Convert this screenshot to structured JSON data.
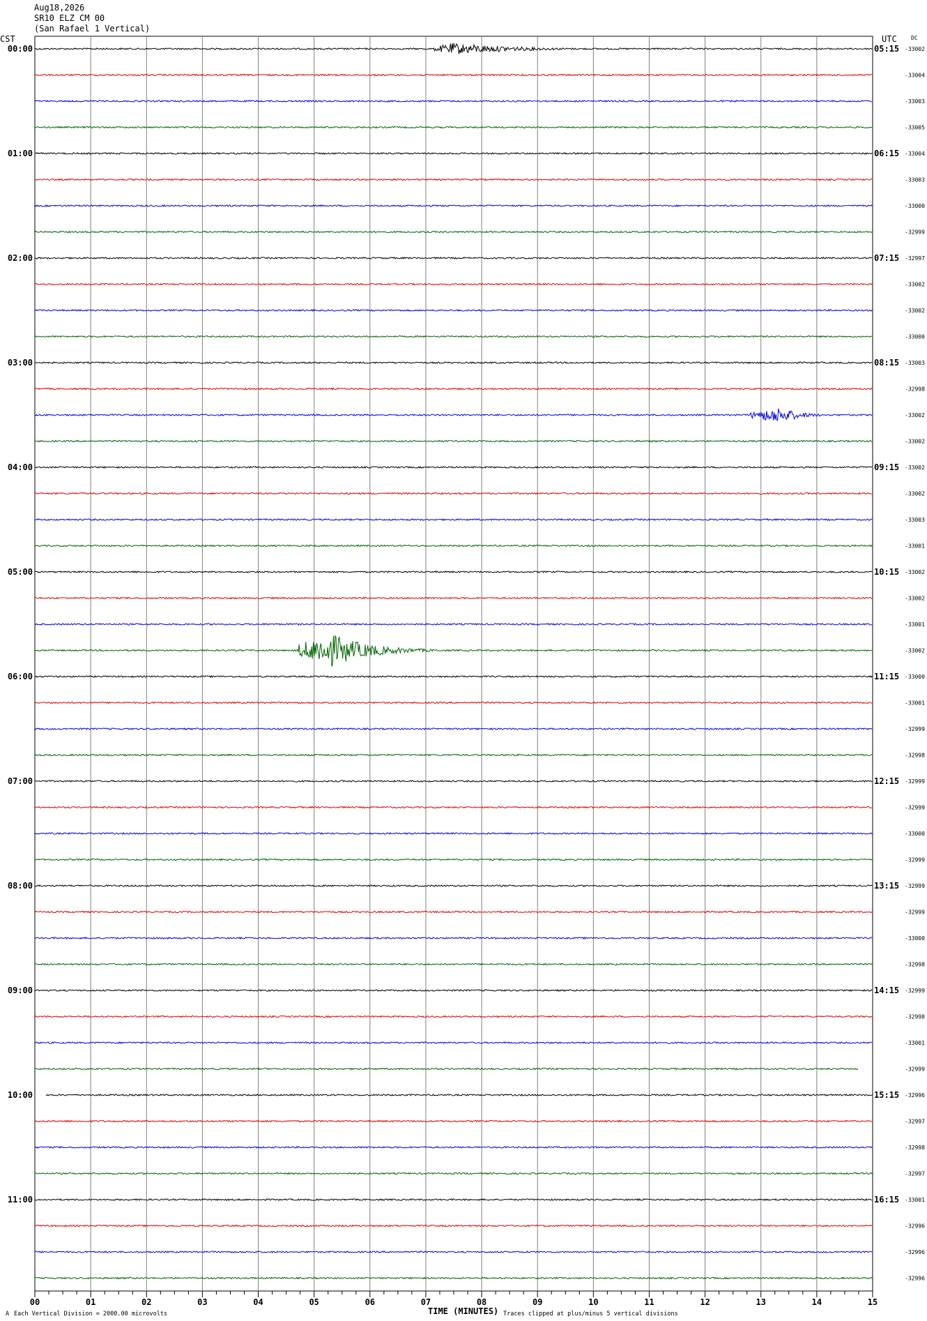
{
  "header": {
    "date": "Aug18,2026",
    "station": "SR10 ELZ CM 00",
    "location": "(San Rafael 1 Vertical)",
    "left_tz": "CST",
    "right_tz": "UTC",
    "dc_label": "DC"
  },
  "footer": {
    "scale_note": "Each Vertical Division = 2000.00 microvolts",
    "xlabel": "TIME (MINUTES)",
    "clip_note": "Traces clipped at plus/minus 5 vertical divisions",
    "corner_mark": "A"
  },
  "colors": {
    "trace_cycle": [
      "#000000",
      "#e00000",
      "#0000e0",
      "#006400"
    ],
    "grid": "#808080"
  },
  "chart_data": {
    "type": "line",
    "description_type": "helicorder",
    "xlim": [
      0,
      15
    ],
    "x_ticks": [
      "00",
      "01",
      "02",
      "03",
      "04",
      "05",
      "06",
      "07",
      "08",
      "09",
      "10",
      "11",
      "12",
      "13",
      "14",
      "15"
    ],
    "rows_per_hour": 4,
    "left_hour_labels": [
      "00:00",
      "01:00",
      "02:00",
      "03:00",
      "04:00",
      "05:00",
      "06:00",
      "07:00",
      "08:00",
      "09:00",
      "10:00",
      "11:00"
    ],
    "right_hour_labels": [
      "05:15",
      "06:15",
      "07:15",
      "08:15",
      "09:15",
      "10:15",
      "11:15",
      "12:15",
      "13:15",
      "14:15",
      "15:15",
      "16:15"
    ],
    "dc_offsets": [
      "-33002",
      "-33004",
      "-33003",
      "-33005",
      "-33004",
      "-33003",
      "-33000",
      "-32999",
      "-32997",
      "-33002",
      "-33002",
      "-33000",
      "-33003",
      "-32998",
      "-33002",
      "-33002",
      "-33002",
      "-33002",
      "-33003",
      "-33001",
      "-33002",
      "-33002",
      "-33001",
      "-33002",
      "-33000",
      "-33001",
      "-32999",
      "-32998",
      "-32999",
      "-32999",
      "-33000",
      "-32999",
      "-32999",
      "-32999",
      "-33000",
      "-32998",
      "-32999",
      "-32998",
      "-33001",
      "-32999",
      "-32996",
      "-32997",
      "-32998",
      "-32997",
      "-33001",
      "-32996",
      "-32996",
      "-32996"
    ],
    "events": [
      {
        "row": 0,
        "start_min": 7.15,
        "peak_min": 7.5,
        "end_min": 11.0,
        "amp_divisions": 0.6
      },
      {
        "row": 1,
        "start_min": 14.5,
        "peak_min": 14.75,
        "end_min": 15.0,
        "amp_divisions": 0.1
      },
      {
        "row": 14,
        "start_min": 12.8,
        "peak_min": 13.35,
        "end_min": 14.5,
        "amp_divisions": 0.8
      },
      {
        "row": 20,
        "start_min": 12.95,
        "peak_min": 13.2,
        "end_min": 15.0,
        "amp_divisions": 0.1
      },
      {
        "row": 23,
        "start_min": 4.7,
        "peak_min": 5.3,
        "end_min": 7.5,
        "amp_divisions": 1.7
      },
      {
        "row": 30,
        "start_min": 8.7,
        "peak_min": 8.9,
        "end_min": 11.0,
        "amp_divisions": 0.08
      }
    ],
    "partial_rows": [
      {
        "row": 39,
        "end_min": 14.75
      },
      {
        "row": 40,
        "start_min": 0.2
      }
    ],
    "grid": true
  }
}
